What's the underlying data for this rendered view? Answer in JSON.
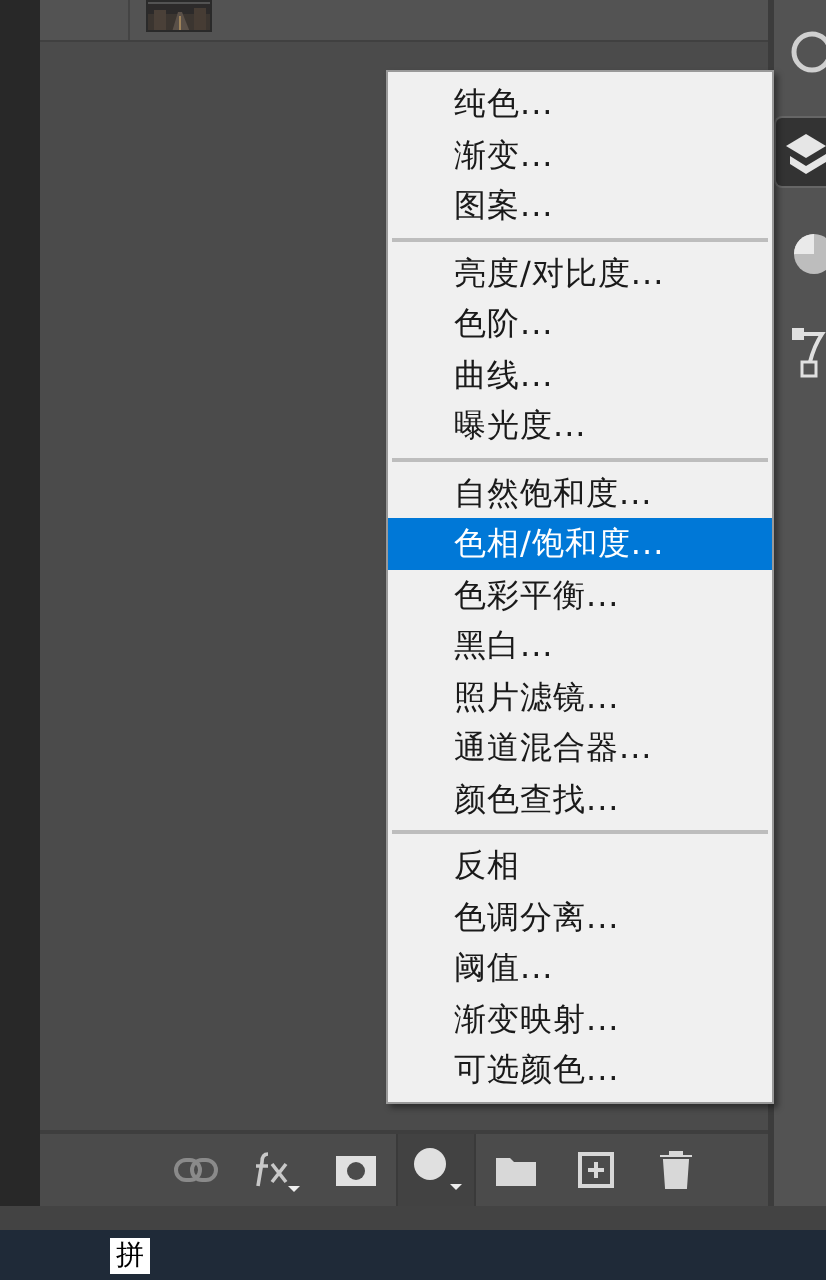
{
  "menu": {
    "groups": [
      {
        "items": [
          {
            "label": "纯色...",
            "selected": false
          },
          {
            "label": "渐变...",
            "selected": false
          },
          {
            "label": "图案...",
            "selected": false
          }
        ]
      },
      {
        "items": [
          {
            "label": "亮度/对比度...",
            "selected": false
          },
          {
            "label": "色阶...",
            "selected": false
          },
          {
            "label": "曲线...",
            "selected": false
          },
          {
            "label": "曝光度...",
            "selected": false
          }
        ]
      },
      {
        "items": [
          {
            "label": "自然饱和度...",
            "selected": false
          },
          {
            "label": "色相/饱和度...",
            "selected": true
          },
          {
            "label": "色彩平衡...",
            "selected": false
          },
          {
            "label": "黑白...",
            "selected": false
          },
          {
            "label": "照片滤镜...",
            "selected": false
          },
          {
            "label": "通道混合器...",
            "selected": false
          },
          {
            "label": "颜色查找...",
            "selected": false
          }
        ]
      },
      {
        "items": [
          {
            "label": "反相",
            "selected": false
          },
          {
            "label": "色调分离...",
            "selected": false
          },
          {
            "label": "阈值...",
            "selected": false
          },
          {
            "label": "渐变映射...",
            "selected": false
          },
          {
            "label": "可选颜色...",
            "selected": false
          }
        ]
      }
    ]
  },
  "toolbar": {
    "buttons": [
      {
        "kind": "link",
        "selected": false
      },
      {
        "kind": "fx",
        "selected": false
      },
      {
        "kind": "mask",
        "selected": false
      },
      {
        "kind": "adjustment",
        "selected": true
      },
      {
        "kind": "group",
        "selected": false
      },
      {
        "kind": "new",
        "selected": false
      },
      {
        "kind": "trash",
        "selected": false
      }
    ]
  },
  "side_dock": {
    "buttons": [
      {
        "kind": "circle",
        "selected": false
      },
      {
        "kind": "layers",
        "selected": true
      },
      {
        "kind": "palette",
        "selected": false
      },
      {
        "kind": "path",
        "selected": false
      }
    ]
  },
  "taskbar": {
    "ime_indicator": "拼"
  }
}
